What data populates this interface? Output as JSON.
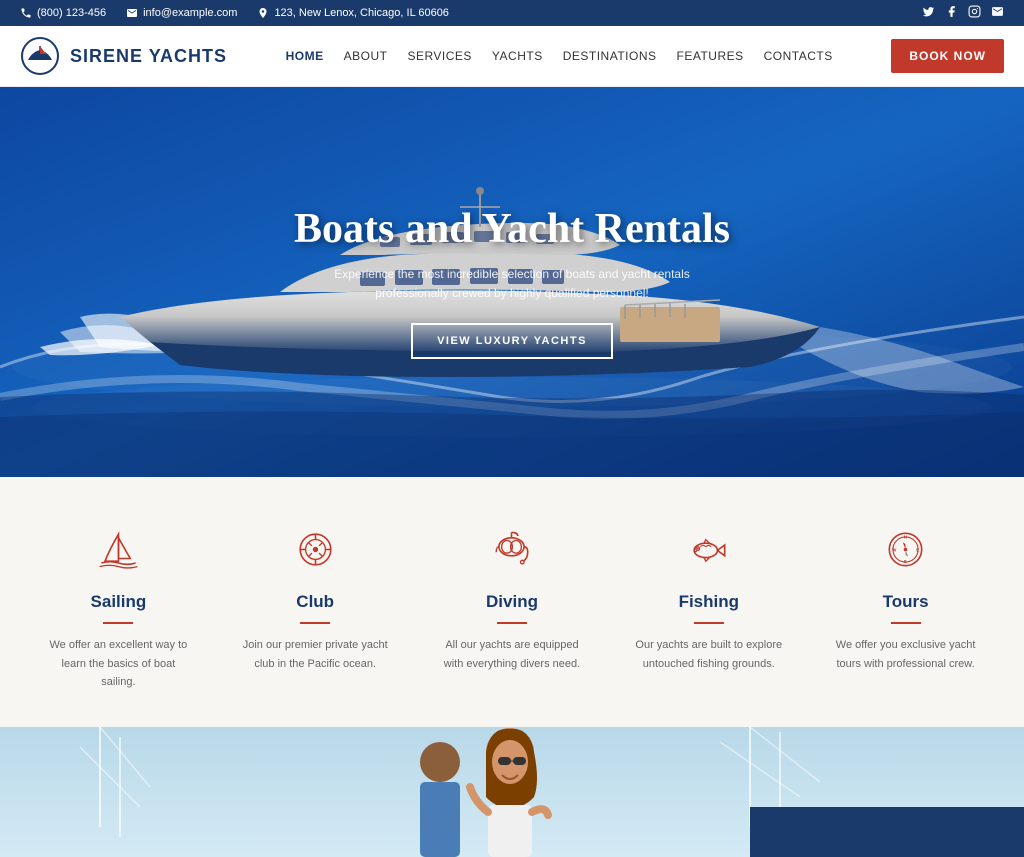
{
  "topbar": {
    "phone": "(800) 123-456",
    "email": "info@example.com",
    "address": "123, New Lenox, Chicago, IL 60606",
    "socials": [
      "twitter",
      "facebook",
      "instagram",
      "email"
    ]
  },
  "header": {
    "logo_text": "SIRENE YACHTS",
    "nav_items": [
      {
        "label": "HOME",
        "active": true
      },
      {
        "label": "ABOUT",
        "active": false
      },
      {
        "label": "SERVICES",
        "active": false
      },
      {
        "label": "YACHTS",
        "active": false
      },
      {
        "label": "DESTINATIONS",
        "active": false
      },
      {
        "label": "FEATURES",
        "active": false
      },
      {
        "label": "CONTACTS",
        "active": false
      }
    ],
    "book_btn": "BOOK NOW"
  },
  "hero": {
    "title": "Boats and Yacht Rentals",
    "subtitle": "Experience the most incredible selection of boats and yacht rentals professionally crewed by highly qualified personnel!",
    "cta_btn": "VIEW LUXURY YACHTS"
  },
  "services": [
    {
      "id": "sailing",
      "title": "Sailing",
      "desc": "We offer an excellent way to learn the basics of boat sailing.",
      "icon": "sailing"
    },
    {
      "id": "club",
      "title": "Club",
      "desc": "Join our premier private yacht club in the Pacific ocean.",
      "icon": "club"
    },
    {
      "id": "diving",
      "title": "Diving",
      "desc": "All our yachts are equipped with everything divers need.",
      "icon": "diving"
    },
    {
      "id": "fishing",
      "title": "Fishing",
      "desc": "Our yachts are built to explore untouched fishing grounds.",
      "icon": "fishing"
    },
    {
      "id": "tours",
      "title": "Tours",
      "desc": "We offer you exclusive yacht tours with professional crew.",
      "icon": "tours"
    }
  ]
}
